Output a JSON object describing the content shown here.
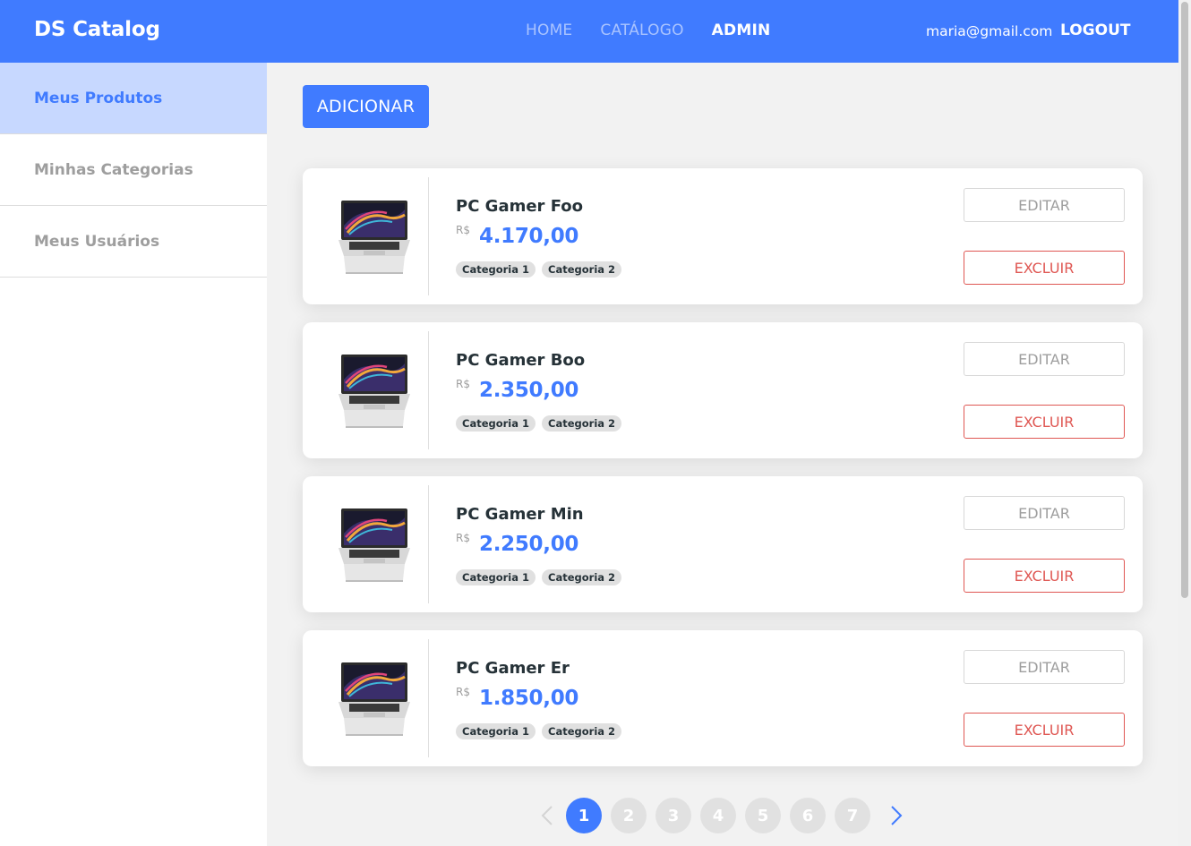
{
  "navbar": {
    "brand": "DS Catalog",
    "links": [
      {
        "label": "HOME",
        "active": false
      },
      {
        "label": "CATÁLOGO",
        "active": false
      },
      {
        "label": "ADMIN",
        "active": true
      }
    ],
    "user_email": "maria@gmail.com",
    "logout_label": "LOGOUT"
  },
  "sidebar": {
    "items": [
      {
        "label": "Meus Produtos",
        "active": true
      },
      {
        "label": "Minhas Categorias",
        "active": false
      },
      {
        "label": "Meus Usuários",
        "active": false
      }
    ]
  },
  "main": {
    "add_label": "ADICIONAR",
    "products": [
      {
        "name": "PC Gamer Foo",
        "currency": "R$",
        "price": "4.170,00",
        "categories": [
          "Categoria 1",
          "Categoria 2"
        ],
        "image_icon": "laptop-image",
        "edit_label": "EDITAR",
        "delete_label": "EXCLUIR"
      },
      {
        "name": "PC Gamer Boo",
        "currency": "R$",
        "price": "2.350,00",
        "categories": [
          "Categoria 1",
          "Categoria 2"
        ],
        "image_icon": "laptop-image",
        "edit_label": "EDITAR",
        "delete_label": "EXCLUIR"
      },
      {
        "name": "PC Gamer Min",
        "currency": "R$",
        "price": "2.250,00",
        "categories": [
          "Categoria 1",
          "Categoria 2"
        ],
        "image_icon": "laptop-image",
        "edit_label": "EDITAR",
        "delete_label": "EXCLUIR"
      },
      {
        "name": "PC Gamer Er",
        "currency": "R$",
        "price": "1.850,00",
        "categories": [
          "Categoria 1",
          "Categoria 2"
        ],
        "image_icon": "laptop-image",
        "edit_label": "EDITAR",
        "delete_label": "EXCLUIR"
      }
    ]
  },
  "pagination": {
    "pages": [
      "1",
      "2",
      "3",
      "4",
      "5",
      "6",
      "7"
    ],
    "current_page": 1,
    "prev_icon": "chevron-left-icon",
    "next_icon": "chevron-right-icon"
  },
  "colors": {
    "primary": "#407bff",
    "sidebar_active_bg": "#c7d8ff",
    "danger": "#df5753",
    "muted": "#9e9e9e",
    "badge_bg": "#e0e0e0",
    "page_inactive": "#e1e1e1"
  }
}
